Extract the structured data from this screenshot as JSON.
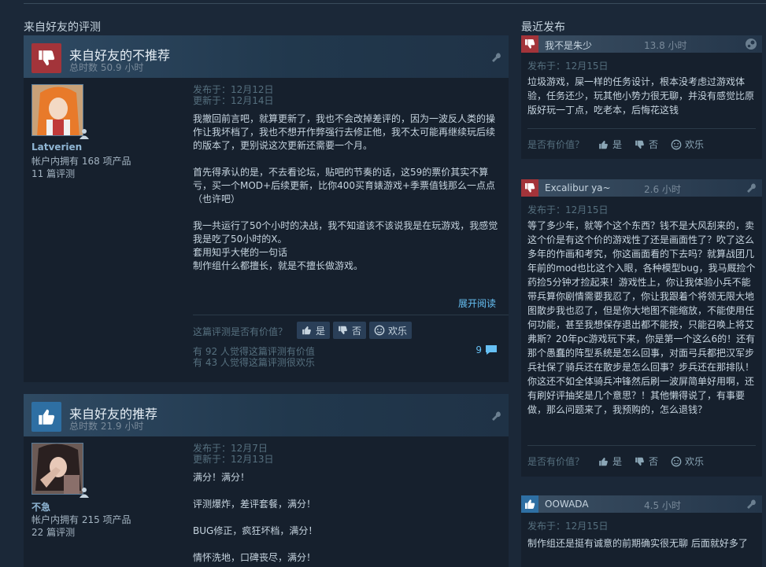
{
  "friends_section": {
    "title": "来自好友的评测"
  },
  "recent_section": {
    "title": "最近发布"
  },
  "reviews": [
    {
      "title": "来自好友的不推荐",
      "hours": "总时数 50.9 小时",
      "author": "Latverien",
      "products": "帐户内拥有 168 项产品",
      "review_count": "11 篇评测",
      "posted": "发布于：12月12日",
      "updated": "更新于：12月14日",
      "paragraphs": [
        "我撤回前言吧，就算更新了，我也不会改掉差评的，因为一波反人类的操作让我坏档了，我也不想开作弊强行去修正他，我不太可能再继续玩后续的版本了，更别说这次更新还需要一个月。",
        "首先得承认的是，不去看论坛，贴吧的节奏的话，这59的票价其实不算亏，买一个MOD+后续更新，比你400买育婊游戏+季票值钱那么一点点（也许吧）",
        "我一共运行了50个小时的决战，我不知道该不该说我是在玩游戏，我感觉我是吃了50小时的X。\n套用知乎大佬的一句话\n制作组什么都擅长，就是不擅长做游戏。"
      ],
      "read_more": "展开阅读",
      "helpful_question": "这篇评测是否有价值？",
      "yes": "是",
      "no": "否",
      "funny": "欢乐",
      "helpful_stat": "有 92 人觉得这篇评测有价值",
      "funny_stat": "有 43 人觉得这篇评测很欢乐",
      "comments": "9"
    },
    {
      "title": "来自好友的推荐",
      "hours": "总时数 21.9 小时",
      "author": "不急",
      "products": "帐户内拥有 215 项产品",
      "review_count": "22 篇评测",
      "posted": "发布于：12月7日",
      "updated": "更新于：12月13日",
      "paragraphs": [
        "满分！满分！",
        "评测爆炸，差评套餐，满分！",
        "BUG修正，疯狂坏档，满分！",
        "情怀洗地，口碑丧尽，满分！"
      ]
    }
  ],
  "recent": [
    {
      "name": "我不是朱少",
      "hours": "13.8 小时",
      "date": "发布于：12月15日",
      "body": "垃圾游戏，屎一样的任务设计，根本没考虑过游戏体验，任务还少，玩其他小势力很无聊，并没有感觉比原版好玩一丁点，吃老本，后悔花这钱",
      "helpful_question": "是否有价值？",
      "yes": "是",
      "no": "否",
      "funny": "欢乐",
      "icon": "steam-icon"
    },
    {
      "name": "Excalibur ya~",
      "hours": "2.6 小时",
      "date": "发布于：12月15日",
      "body": "等了多少年，就等个这个东西？钱不是大风刮来的，卖这个价是有这个价的游戏性了还是画面性了？吹了这么多年的作画和考究，你这画面看的下去吗？就算战团几年前的mod也比这个入眼，各种模型bug，我马厩捡个药捡5分钟才捡起来！游戏性上，你让我体验小兵不能带兵算你剧情需要我忍了，你让我跟着个将领无限大地图散步我也忍了，但是你大地图不能缩放，不能使用任何功能，甚至我想保存退出都不能按，只能召唤上将艾弗斯？20年pc游戏玩下来，你是第一个这么6的！还有那个愚蠢的阵型系统是怎么回事，对面弓兵都把汉军步兵社保了骑兵还在散步是怎么回事？步兵还在那排队！你这还不如全体骑兵冲锋然后刷一波屏简单好用啊，还有刷好评抽奖是几个意思？！其他懒得说了，有事要做，那么问题来了，我预购的，怎么退钱？",
      "helpful_question": "是否有价值？",
      "yes": "是",
      "no": "否",
      "funny": "欢乐",
      "icon": "wrench-icon"
    },
    {
      "name": "OOWADA",
      "hours": "4.5 小时",
      "date": "发布于：12月15日",
      "body": "制作组还是挺有诚意的前期确实很无聊 后面就好多了",
      "icon": "wrench-icon"
    }
  ],
  "colors": {
    "negative": "#a3343a",
    "positive": "#2e6fa3",
    "link": "#66c0f4"
  }
}
